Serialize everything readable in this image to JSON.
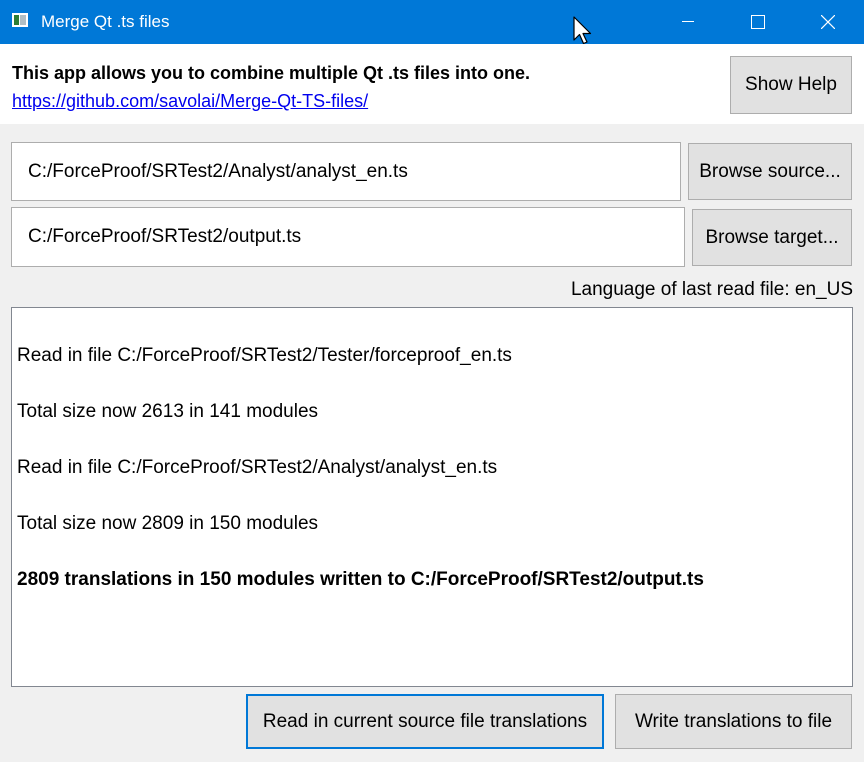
{
  "window": {
    "title": "Merge Qt .ts files",
    "icons": [
      "app-window-icon",
      "minimize-icon",
      "maximize-icon",
      "close-icon",
      "mouse-cursor-icon"
    ]
  },
  "header": {
    "intro": "This app allows you to combine multiple Qt .ts files into one.",
    "link": "https://github.com/savolai/Merge-Qt-TS-files/",
    "help_button": "Show Help"
  },
  "source": {
    "value": "C:/ForceProof/SRTest2/Analyst/analyst_en.ts",
    "browse_button": "Browse source..."
  },
  "target": {
    "value": "C:/ForceProof/SRTest2/output.ts",
    "browse_button": "Browse target..."
  },
  "language_label": "Language of last read file: en_US",
  "log": {
    "lines": [
      "Read in file C:/ForceProof/SRTest2/Tester/forceproof_en.ts",
      "Total size now 2613 in 141 modules",
      "Read in file C:/ForceProof/SRTest2/Analyst/analyst_en.ts",
      "Total size now 2809 in 150 modules",
      "2809 translations in 150 modules written to C:/ForceProof/SRTest2/output.ts"
    ]
  },
  "actions": {
    "read_button": "Read in current source file translations",
    "write_button": "Write translations to file"
  },
  "colors": {
    "titlebar": "#0078d7",
    "link": "#0000ee",
    "focus_border": "#0078d7"
  }
}
